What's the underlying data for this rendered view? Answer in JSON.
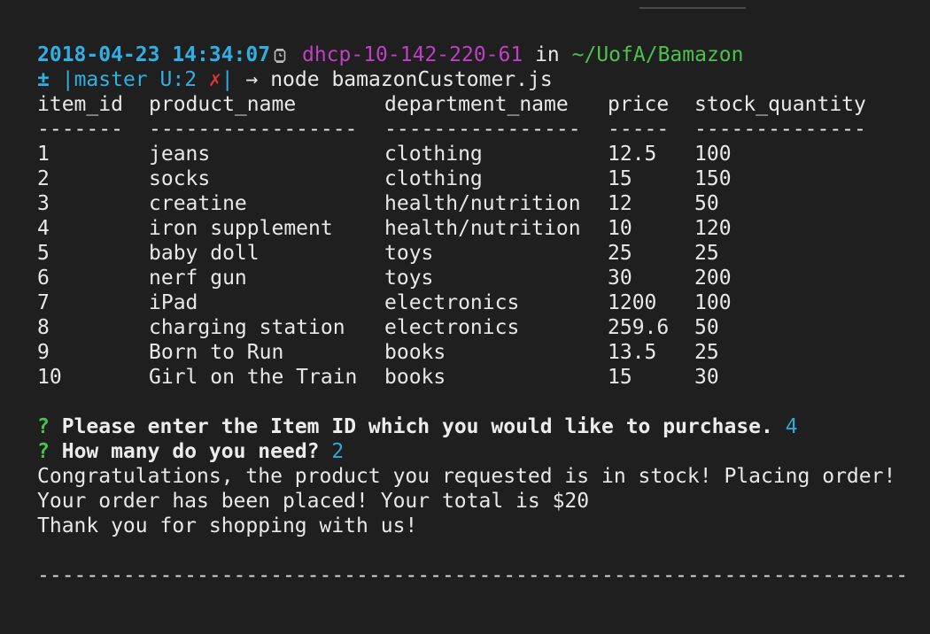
{
  "prompt": {
    "timestamp": "2018-04-23 14:34:07",
    "host": "dhcp-10-142-220-61",
    "in_word": "in",
    "cwd": "~/UofA/Bamazon",
    "plusminus": "±",
    "git_branch": "|master U:2",
    "git_dirty": "✗",
    "git_close": "|",
    "arrow": "→",
    "command": "node bamazonCustomer.js"
  },
  "table": {
    "headers": [
      "item_id",
      "product_name",
      "department_name",
      "price",
      "stock_quantity"
    ],
    "separators": [
      "-------",
      "-----------------",
      "----------------",
      "-----",
      "--------------"
    ],
    "rows": [
      [
        "1",
        "jeans",
        "clothing",
        "12.5",
        "100"
      ],
      [
        "2",
        "socks",
        "clothing",
        "15",
        "150"
      ],
      [
        "3",
        "creatine",
        "health/nutrition",
        "12",
        "50"
      ],
      [
        "4",
        "iron supplement",
        "health/nutrition",
        "10",
        "120"
      ],
      [
        "5",
        "baby doll",
        "toys",
        "25",
        "25"
      ],
      [
        "6",
        "nerf gun",
        "toys",
        "30",
        "200"
      ],
      [
        "7",
        "iPad",
        "electronics",
        "1200",
        "100"
      ],
      [
        "8",
        "charging station",
        "electronics",
        "259.6",
        "50"
      ],
      [
        "9",
        "Born to Run",
        "books",
        "13.5",
        "25"
      ],
      [
        "10",
        "Girl on the Train",
        "books",
        "15",
        "30"
      ]
    ]
  },
  "dialog": {
    "q1_mark": "?",
    "q1_text": "Please enter the Item ID which you would like to purchase.",
    "q1_answer": "4",
    "q2_mark": "?",
    "q2_text": "How many do you need?",
    "q2_answer": "2",
    "line1": "Congratulations, the product you requested is in stock! Placing order!",
    "line2": "Your order has been placed! Your total is $20",
    "line3": "Thank you for shopping with us!",
    "rule": "-----------------------------------------------------------------------"
  },
  "colors": {
    "background": "#1f1f1f",
    "timestamp": "#2fb0e4",
    "host": "#c03fc6",
    "path": "#4bc24b",
    "git_dirty": "#e0353a",
    "answer": "#2fa8dc"
  },
  "icons": {
    "clock": "clock-icon"
  }
}
